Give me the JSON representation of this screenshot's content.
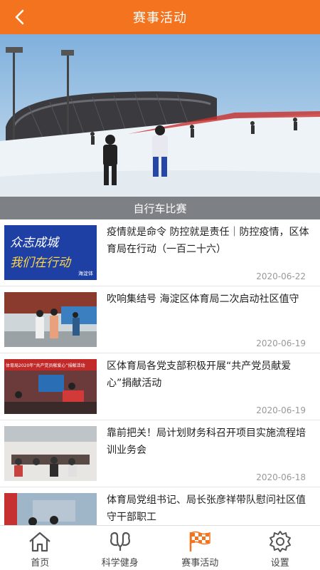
{
  "header": {
    "title": "赛事活动",
    "back_icon": "chevron-left-icon"
  },
  "banner": {
    "caption": "自行车比赛"
  },
  "articles": [
    {
      "title": "疫情就是命令 防控就是责任｜防控疫情，区体育局在行动（一百二十六）",
      "date": "2020-06-22"
    },
    {
      "title": "吹响集结号 海淀区体育局二次启动社区值守",
      "date": "2020-06-19"
    },
    {
      "title": "区体育局各党支部积极开展“共产党员献爱心”捐献活动",
      "date": "2020-06-19"
    },
    {
      "title": "靠前把关！局计划财务科召开项目实施流程培训业务会",
      "date": "2020-06-18"
    },
    {
      "title": "体育局党组书记、局长张彦祥带队慰问社区值守干部职工",
      "date": ""
    }
  ],
  "thumb1_text": {
    "line1": "众志成城",
    "line2": "我们在行动",
    "tag": "海淀体"
  },
  "thumb3_text": {
    "banner": "体育局2020年“共产党员献爱心”捐献活动"
  },
  "tabs": [
    {
      "label": "首页",
      "icon": "home-icon"
    },
    {
      "label": "科学健身",
      "icon": "fitness-icon"
    },
    {
      "label": "赛事活动",
      "icon": "checkered-flag-icon"
    },
    {
      "label": "设置",
      "icon": "gear-icon"
    }
  ],
  "colors": {
    "accent": "#f4731f",
    "active_tab_icon": "#f4731f",
    "inactive_tab_icon": "#555555"
  }
}
